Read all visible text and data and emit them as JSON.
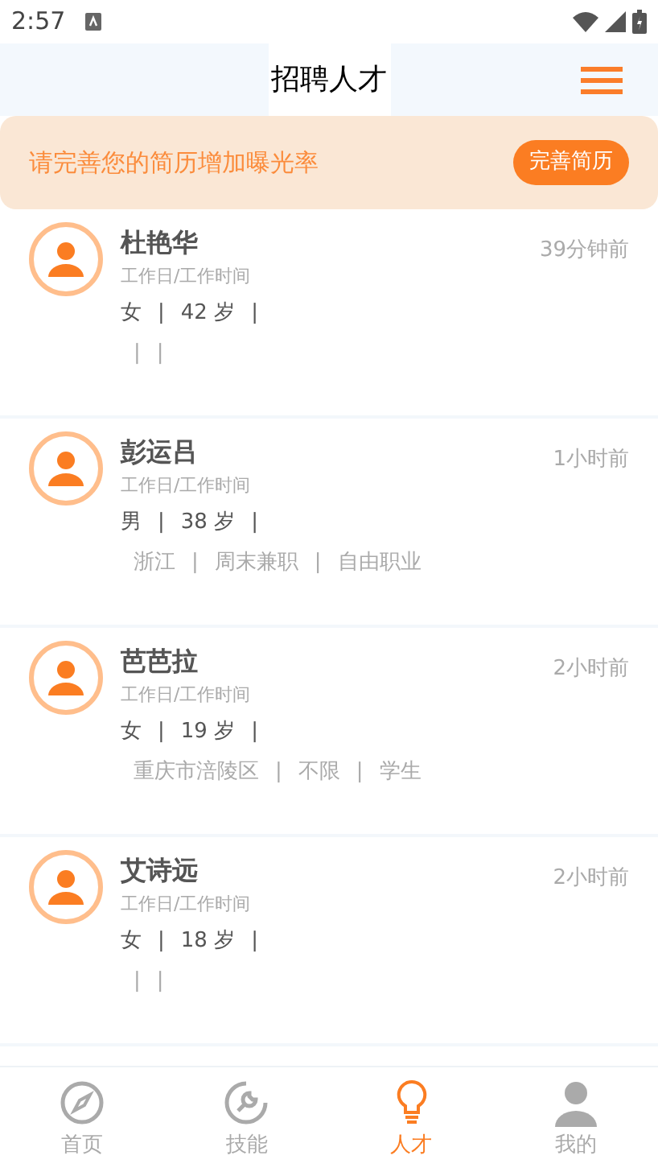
{
  "status_bar": {
    "time": "2:57"
  },
  "header": {
    "title": "招聘人才"
  },
  "banner": {
    "text": "请完善您的简历增加曝光率",
    "button": "完善简历"
  },
  "people": [
    {
      "name": "杜艳华",
      "schedule": "工作日/工作时间",
      "time": "39分钟前",
      "info": [
        "女",
        "|",
        "42 岁",
        "|"
      ],
      "tags": [
        "|",
        "|"
      ]
    },
    {
      "name": "彭运吕",
      "schedule": "工作日/工作时间",
      "time": "1小时前",
      "info": [
        "男",
        "|",
        "38 岁",
        "|"
      ],
      "tags": [
        "浙江",
        "|",
        "周末兼职",
        "|",
        "自由职业"
      ]
    },
    {
      "name": "芭芭拉",
      "schedule": "工作日/工作时间",
      "time": "2小时前",
      "info": [
        "女",
        "|",
        "19 岁",
        "|"
      ],
      "tags": [
        "重庆市涪陵区",
        "|",
        "不限",
        "|",
        "学生"
      ]
    },
    {
      "name": "艾诗远",
      "schedule": "工作日/工作时间",
      "time": "2小时前",
      "info": [
        "女",
        "|",
        "18 岁",
        "|"
      ],
      "tags": [
        "|",
        "|"
      ]
    }
  ],
  "nav": [
    {
      "kind": "compass",
      "label": "首页",
      "selected": false
    },
    {
      "kind": "wrench",
      "label": "技能",
      "selected": false
    },
    {
      "kind": "bulb",
      "label": "人才",
      "selected": true
    },
    {
      "kind": "person",
      "label": "我的",
      "selected": false
    }
  ]
}
